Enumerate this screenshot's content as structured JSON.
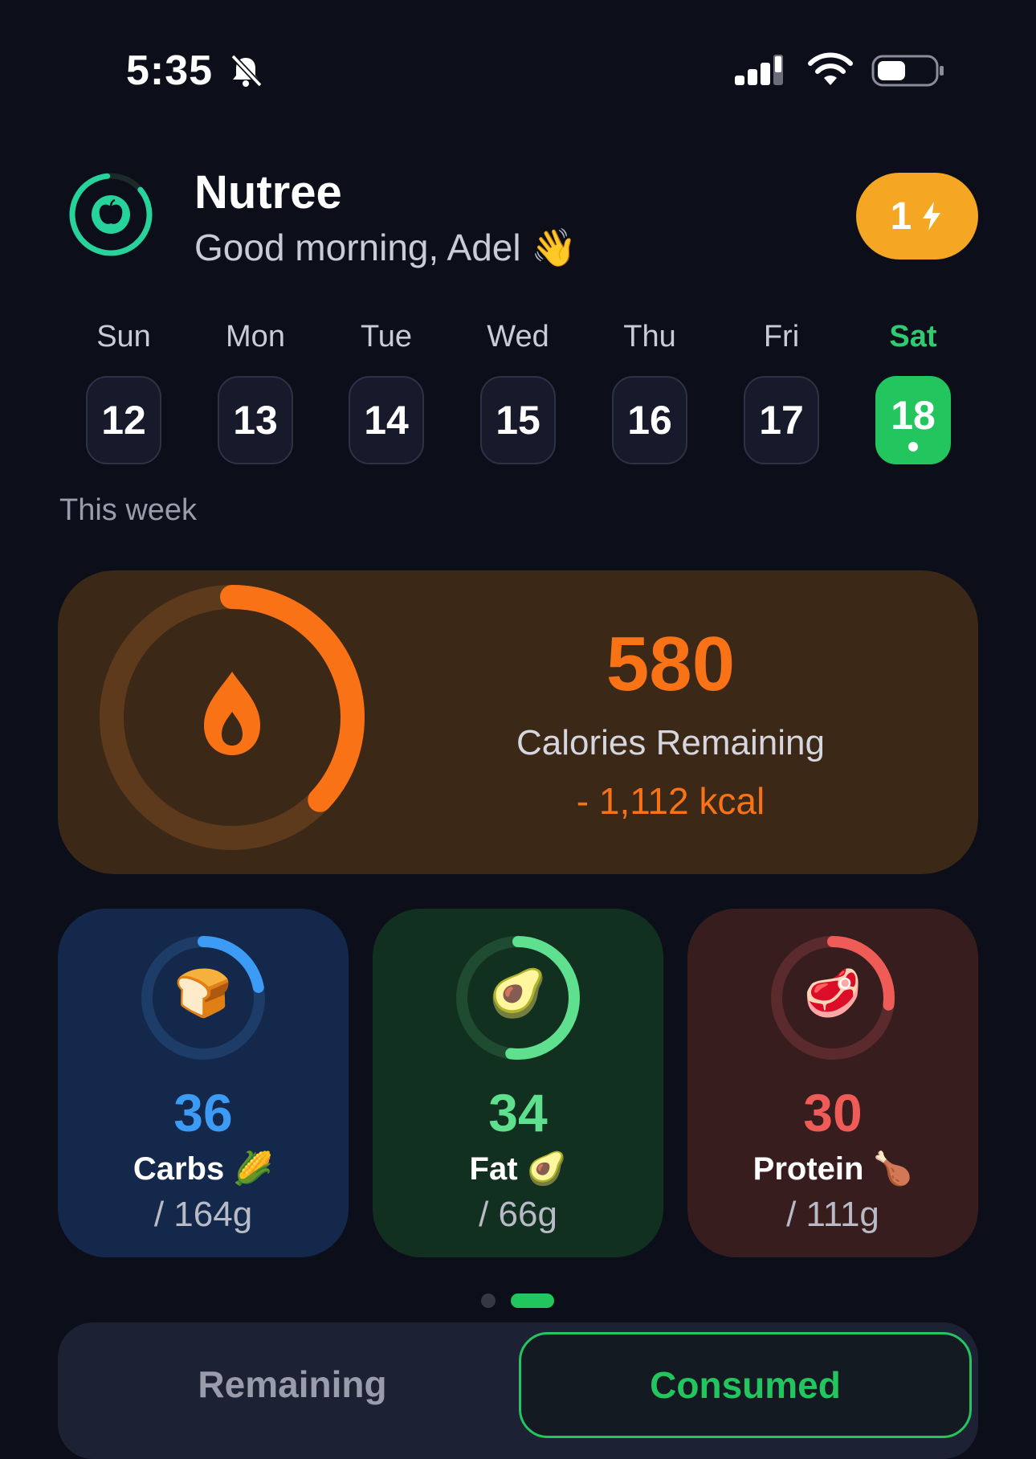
{
  "status_bar": {
    "time": "5:35",
    "bell_icon": "bell-slash-icon",
    "signal_icon": "cellular-signal-icon",
    "wifi_icon": "wifi-icon",
    "battery_icon": "battery-icon"
  },
  "header": {
    "app_name": "Nutree",
    "greeting": "Good morning, Adel",
    "greeting_emoji": "👋",
    "logo_icon": "apple-icon",
    "streak_count": "1",
    "streak_icon": "lightning-icon"
  },
  "week": {
    "days": [
      {
        "name": "Sun",
        "date": "12",
        "active": false
      },
      {
        "name": "Mon",
        "date": "13",
        "active": false
      },
      {
        "name": "Tue",
        "date": "14",
        "active": false
      },
      {
        "name": "Wed",
        "date": "15",
        "active": false
      },
      {
        "name": "Thu",
        "date": "16",
        "active": false
      },
      {
        "name": "Fri",
        "date": "17",
        "active": false
      },
      {
        "name": "Sat",
        "date": "18",
        "active": true
      }
    ],
    "label": "This week"
  },
  "calories": {
    "value": "580",
    "label": "Calories Remaining",
    "kcal": "- 1,112 kcal",
    "icon": "flame-icon",
    "progress": 0.37,
    "color": "#f97316"
  },
  "macros": [
    {
      "key": "carbs",
      "emoji": "🍞",
      "value": "36",
      "name": "Carbs 🌽",
      "goal": "/ 164g",
      "progress": 0.22,
      "color": "#3b9bf5",
      "track": "#1d3c68"
    },
    {
      "key": "fat",
      "emoji": "🥑",
      "value": "34",
      "name": "Fat 🥑",
      "goal": "/ 66g",
      "progress": 0.52,
      "color": "#5ee08f",
      "track": "#1f4b31"
    },
    {
      "key": "protein",
      "emoji": "🥩",
      "value": "30",
      "name": "Protein 🍗",
      "goal": "/ 111g",
      "progress": 0.27,
      "color": "#ef5b57",
      "track": "#5a2a2c"
    }
  ],
  "pager": {
    "pages": 2,
    "active": 2
  },
  "segmented": {
    "remaining": "Remaining",
    "consumed": "Consumed",
    "selected": "consumed"
  }
}
